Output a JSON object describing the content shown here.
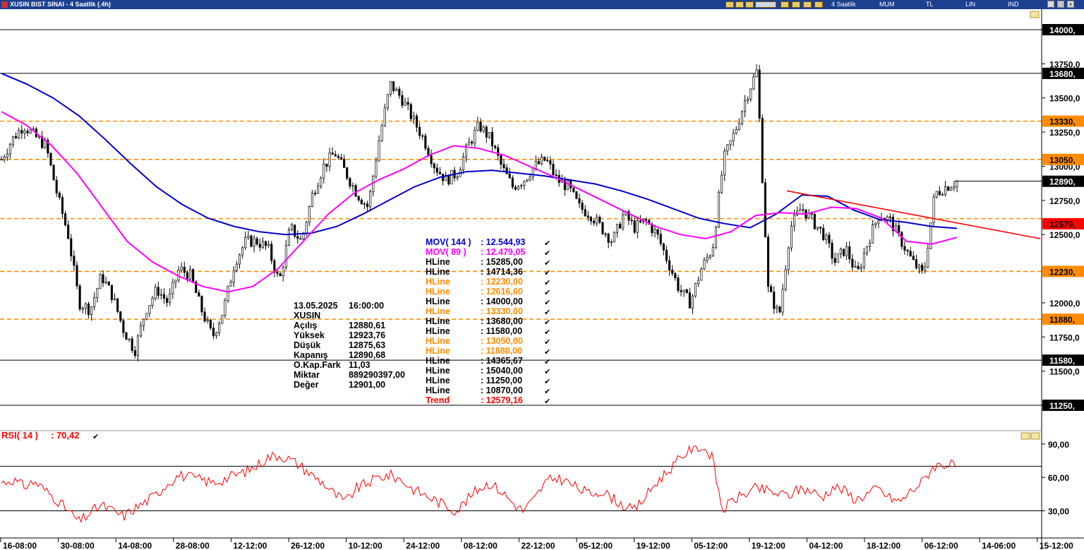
{
  "window": {
    "title": "XUSIN BIST SINAI - 4 Saatlik (.4h)",
    "toolbar": [
      "4 Saatlik",
      "MUM",
      "TL",
      "LIN",
      "IND"
    ]
  },
  "chart_data": {
    "type": "candlestick",
    "symbol": "XUSIN",
    "price_panel": {
      "ylim": [
        11100,
        14150
      ],
      "y_ticks": [
        "14000,",
        "13750,0",
        "13680,",
        "13500,0",
        "13330,",
        "13250,0",
        "13050,",
        "13000,0",
        "12890,",
        "12750,0",
        "12579,",
        "12500,0",
        "12230,",
        "12000,0",
        "11880,",
        "11750,0",
        "11580,",
        "11500,0",
        "11250,"
      ],
      "grey_ticks": [
        {
          "label": "14000,",
          "value": 14000
        },
        {
          "label": "13750,0",
          "value": 13750
        },
        {
          "label": "13500,0",
          "value": 13500
        },
        {
          "label": "13250,0",
          "value": 13250
        },
        {
          "label": "13000,0",
          "value": 13000
        },
        {
          "label": "12750,0",
          "value": 12750
        },
        {
          "label": "12500,0",
          "value": 12500
        },
        {
          "label": "12000,0",
          "value": 12000
        },
        {
          "label": "11750,0",
          "value": 11750
        },
        {
          "label": "11500,0",
          "value": 11500
        },
        {
          "label": "11250,",
          "value": 11250
        }
      ],
      "highlight_ticks": [
        {
          "label": "14000,",
          "value": 14000,
          "color": "#000000"
        },
        {
          "label": "13680,",
          "value": 13680,
          "color": "#000000"
        },
        {
          "label": "13330,",
          "value": 13330,
          "color": "#ff8c00"
        },
        {
          "label": "13050,",
          "value": 13050,
          "color": "#ff8c00"
        },
        {
          "label": "12890,",
          "value": 12890,
          "color": "#000000"
        },
        {
          "label": "12579,",
          "value": 12579,
          "color": "#ff0000"
        },
        {
          "label": "12230,",
          "value": 12230,
          "color": "#ff8c00"
        },
        {
          "label": "11880,",
          "value": 11880,
          "color": "#ff8c00"
        },
        {
          "label": "11580,",
          "value": 11580,
          "color": "#000000"
        },
        {
          "label": "11250,",
          "value": 11250,
          "color": "#000000"
        }
      ],
      "hlines": [
        {
          "value": 14000,
          "color": "#000000",
          "dashed": false
        },
        {
          "value": 13680,
          "color": "#000000",
          "dashed": false
        },
        {
          "value": 13330,
          "color": "#ff8c00",
          "dashed": true
        },
        {
          "value": 13050,
          "color": "#ff8c00",
          "dashed": true
        },
        {
          "value": 12616.6,
          "color": "#ff8c00",
          "dashed": true
        },
        {
          "value": 12230,
          "color": "#ff8c00",
          "dashed": true
        },
        {
          "value": 11880,
          "color": "#ff8c00",
          "dashed": true
        },
        {
          "value": 11580,
          "color": "#000000",
          "dashed": false
        },
        {
          "value": 11250,
          "color": "#000000",
          "dashed": false
        }
      ],
      "last_close": 12890.68,
      "close_series": [
        13050,
        13200,
        13300,
        13220,
        13150,
        12800,
        12500,
        12000,
        11950,
        12200,
        12050,
        11800,
        11650,
        11950,
        12100,
        12000,
        12250,
        12200,
        11950,
        11750,
        11950,
        12300,
        12450,
        12450,
        12400,
        12150,
        12550,
        12450,
        12800,
        13000,
        13100,
        12950,
        12800,
        12700,
        13200,
        13600,
        13500,
        13350,
        13200,
        13000,
        12900,
        12950,
        13150,
        13300,
        13200,
        13000,
        12850,
        12900,
        13000,
        13050,
        12900,
        12850,
        12700,
        12650,
        12550,
        12450,
        12650,
        12550,
        12600,
        12500,
        12300,
        12100,
        12000,
        12250,
        12400,
        13050,
        13250,
        13500,
        13700,
        12100,
        11900,
        12550,
        12700,
        12600,
        12500,
        12300,
        12400,
        12200,
        12450,
        12650,
        12600,
        12450,
        12300,
        12200,
        12800,
        12850,
        12890
      ],
      "candle_x_range": [
        2,
        1356
      ],
      "mov144": [
        13680,
        13600,
        13500,
        13370,
        13200,
        13020,
        12850,
        12720,
        12620,
        12560,
        12520,
        12500,
        12510,
        12560,
        12650,
        12750,
        12850,
        12920,
        12960,
        12970,
        12950,
        12930,
        12900,
        12870,
        12820,
        12760,
        12690,
        12620,
        12580,
        12550,
        12650,
        12790,
        12780,
        12680,
        12610,
        12590,
        12560,
        12545
      ],
      "mov89": [
        13400,
        13300,
        13150,
        12950,
        12700,
        12450,
        12300,
        12200,
        12120,
        12080,
        12120,
        12250,
        12450,
        12650,
        12800,
        12900,
        12980,
        13080,
        13150,
        13130,
        13080,
        13000,
        12920,
        12830,
        12740,
        12650,
        12560,
        12500,
        12470,
        12520,
        12640,
        12660,
        12650,
        12700,
        12690,
        12620,
        12450,
        12430,
        12479
      ],
      "trend": {
        "from": 12820,
        "to": 12470,
        "x_from": 1115,
        "x_to": 1474
      }
    },
    "info_box": {
      "date": "13.05.2025",
      "time": "16:00:00",
      "symbol": "XUSIN",
      "rows": [
        {
          "label": "Açılış",
          "value": "12880,61"
        },
        {
          "label": "Yüksek",
          "value": "12923,76"
        },
        {
          "label": "Düşük",
          "value": "12875,63"
        },
        {
          "label": "Kapanış",
          "value": "12890,68"
        },
        {
          "label": "O.Kap.Fark",
          "value": "11,03"
        },
        {
          "label": "Miktar",
          "value": "889290397,00"
        },
        {
          "label": "Değer",
          "value": "12901,00"
        }
      ]
    },
    "legend": [
      {
        "label": "MOV( 144 )",
        "value": ": 12.544,93",
        "color": "#0000cc"
      },
      {
        "label": "MOV( 89 )",
        "value": ": 12.479,05",
        "color": "#ff00ff"
      },
      {
        "label": "HLine",
        "value": ": 15285,00",
        "color": "#000000"
      },
      {
        "label": "HLine",
        "value": ": 14714,36",
        "color": "#000000"
      },
      {
        "label": "HLine",
        "value": ": 12230,00",
        "color": "#ff8c00"
      },
      {
        "label": "HLine",
        "value": ": 12616,60",
        "color": "#ff8c00"
      },
      {
        "label": "HLine",
        "value": ": 14000,00",
        "color": "#000000"
      },
      {
        "label": "HLine",
        "value": ": 13330,00",
        "color": "#ff8c00"
      },
      {
        "label": "HLine",
        "value": ": 13680,00",
        "color": "#000000"
      },
      {
        "label": "HLine",
        "value": ": 11580,00",
        "color": "#000000"
      },
      {
        "label": "HLine",
        "value": ": 13050,00",
        "color": "#ff8c00"
      },
      {
        "label": "HLine",
        "value": ": 11880,00",
        "color": "#ff8c00"
      },
      {
        "label": "HLine",
        "value": ": 14365,67",
        "color": "#000000"
      },
      {
        "label": "HLine",
        "value": ": 15040,00",
        "color": "#000000"
      },
      {
        "label": "HLine",
        "value": ": 11250,00",
        "color": "#000000"
      },
      {
        "label": "HLine",
        "value": ": 10870,00",
        "color": "#000000"
      },
      {
        "label": "Trend",
        "value": ": 12579,16",
        "color": "#ff0000"
      }
    ],
    "rsi_panel": {
      "label": "RSI( 14 )",
      "value": ": 70,42",
      "ylim": [
        10,
        100
      ],
      "y_ticks": [
        {
          "label": "90,00",
          "value": 90
        },
        {
          "label": "60,00",
          "value": 60
        },
        {
          "label": "30,00",
          "value": 30
        }
      ],
      "hlines": [
        70,
        30
      ],
      "series": [
        55,
        58,
        52,
        56,
        48,
        40,
        30,
        20,
        28,
        35,
        30,
        25,
        32,
        38,
        45,
        55,
        62,
        60,
        58,
        55,
        58,
        62,
        65,
        70,
        78,
        80,
        76,
        70,
        62,
        55,
        45,
        38,
        50,
        55,
        60,
        62,
        58,
        50,
        45,
        40,
        35,
        30,
        40,
        50,
        55,
        48,
        38,
        30,
        40,
        55,
        60,
        56,
        50,
        45,
        48,
        42,
        35,
        30,
        42,
        55,
        65,
        75,
        85,
        88,
        80,
        30,
        40,
        45,
        50,
        48,
        45,
        44,
        50,
        48,
        42,
        52,
        48,
        40,
        45,
        50,
        42,
        38,
        48,
        56,
        70,
        72,
        70
      ]
    },
    "x_ticks": [
      "16-08:00",
      "30-08:00",
      "14-08:00",
      "28-08:00",
      "12-12:00",
      "26-12:00",
      "10-12:00",
      "24-12:00",
      "08-12:00",
      "22-12:00",
      "05-12:00",
      "19-12:00",
      "05-12:00",
      "19-12:00",
      "04-12:00",
      "18-12:00",
      "06-12:00",
      "14-06:00",
      "15-12:00"
    ]
  }
}
